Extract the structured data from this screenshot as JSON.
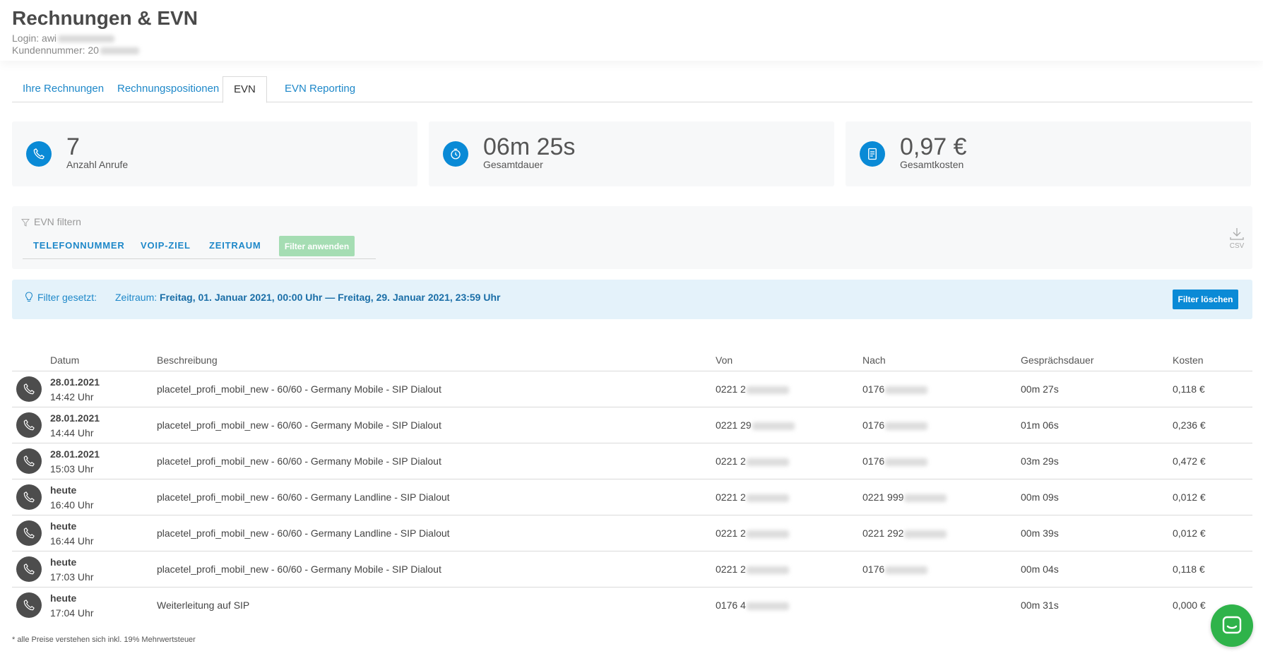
{
  "header": {
    "title": "Rechnungen & EVN",
    "login_label": "Login: awi",
    "customer_label": "Kundennummer: 20"
  },
  "tabs": [
    {
      "label": "Ihre Rechnungen",
      "active": false
    },
    {
      "label": "Rechnungspositionen",
      "active": false
    },
    {
      "label": "EVN",
      "active": true
    },
    {
      "label": "EVN Reporting",
      "active": false
    }
  ],
  "stats": [
    {
      "value": "7",
      "label": "Anzahl Anrufe",
      "icon": "phone-icon"
    },
    {
      "value": "06m 25s",
      "label": "Gesamtdauer",
      "icon": "clock-icon"
    },
    {
      "value": "0,97 €",
      "label": "Gesamtkosten",
      "icon": "invoice-icon"
    }
  ],
  "filter": {
    "title": "EVN filtern",
    "tabs": [
      "TELEFONNUMMER",
      "VOIP-ZIEL",
      "ZEITRAUM"
    ],
    "apply_label": "Filter anwenden",
    "csv_label": "CSV"
  },
  "active_filter": {
    "label": "Filter gesetzt:",
    "prefix": "Zeitraum: ",
    "value": "Freitag, 01. Januar 2021, 00:00 Uhr — Freitag, 29. Januar 2021, 23:59 Uhr",
    "clear_label": "Filter löschen"
  },
  "table": {
    "headers": [
      "Datum",
      "Beschreibung",
      "Von",
      "Nach",
      "Gesprächsdauer",
      "Kosten"
    ],
    "rows": [
      {
        "date": "28.01.2021",
        "time": "14:42 Uhr",
        "desc": "placetel_profi_mobil_new - 60/60 - Germany Mobile - SIP Dialout",
        "from": "0221 2",
        "to": "0176",
        "duration": "00m 27s",
        "cost": "0,118 €"
      },
      {
        "date": "28.01.2021",
        "time": "14:44 Uhr",
        "desc": "placetel_profi_mobil_new - 60/60 - Germany Mobile - SIP Dialout",
        "from": "0221 29",
        "to": "0176",
        "duration": "01m 06s",
        "cost": "0,236 €"
      },
      {
        "date": "28.01.2021",
        "time": "15:03 Uhr",
        "desc": "placetel_profi_mobil_new - 60/60 - Germany Mobile - SIP Dialout",
        "from": "0221 2",
        "to": "0176",
        "duration": "03m 29s",
        "cost": "0,472 €"
      },
      {
        "date": "heute",
        "time": "16:40 Uhr",
        "desc": "placetel_profi_mobil_new - 60/60 - Germany Landline - SIP Dialout",
        "from": "0221 2",
        "to": "0221 999",
        "duration": "00m 09s",
        "cost": "0,012 €"
      },
      {
        "date": "heute",
        "time": "16:44 Uhr",
        "desc": "placetel_profi_mobil_new - 60/60 - Germany Landline - SIP Dialout",
        "from": "0221 2",
        "to": "0221 292",
        "duration": "00m 39s",
        "cost": "0,012 €"
      },
      {
        "date": "heute",
        "time": "17:03 Uhr",
        "desc": "placetel_profi_mobil_new - 60/60 - Germany Mobile - SIP Dialout",
        "from": "0221 2",
        "to": "0176",
        "duration": "00m 04s",
        "cost": "0,118 €"
      },
      {
        "date": "heute",
        "time": "17:04 Uhr",
        "desc": "Weiterleitung auf SIP",
        "from": "0176 4",
        "to": "",
        "duration": "00m 31s",
        "cost": "0,000 €"
      }
    ]
  },
  "footnote": "* alle Preise verstehen sich inkl. 19% Mehrwertsteuer",
  "colors": {
    "accent": "#0a8ad6",
    "link": "#1e88c9",
    "apply_button": "#a5ddb3",
    "chat_button": "#2fb34a"
  }
}
